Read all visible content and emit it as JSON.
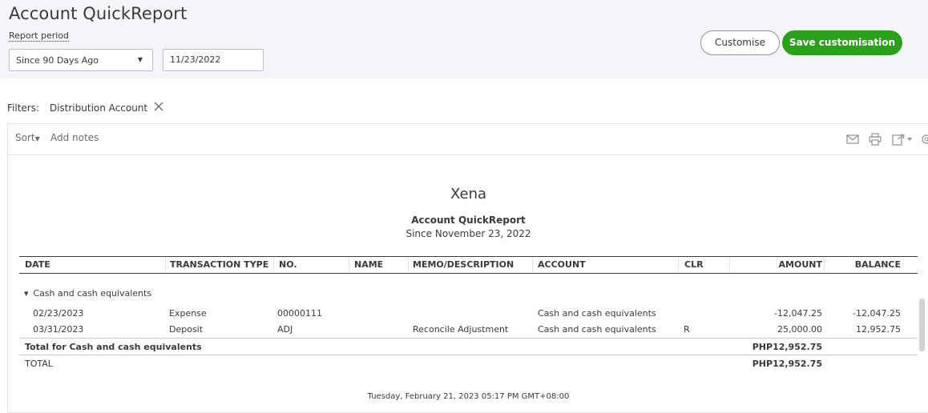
{
  "header": {
    "title": "Account QuickReport",
    "period_label": "Report period",
    "period_value": "Since 90 Days Ago",
    "date_value": "11/23/2022",
    "customise_label": "Customise",
    "save_label": "Save customisation"
  },
  "filters": {
    "label": "Filters:",
    "chip": "Distribution Account"
  },
  "toolbar": {
    "sort_label": "Sort",
    "add_notes_label": "Add notes",
    "icons": [
      "email-icon",
      "print-icon",
      "export-icon",
      "settings-icon"
    ]
  },
  "report": {
    "company": "Xena",
    "title": "Account QuickReport",
    "subtitle": "Since November 23, 2022",
    "columns": [
      "DATE",
      "TRANSACTION TYPE",
      "NO.",
      "NAME",
      "MEMO/DESCRIPTION",
      "ACCOUNT",
      "CLR",
      "AMOUNT",
      "BALANCE"
    ],
    "group_label": "Cash and cash equivalents",
    "rows": [
      {
        "date": "02/23/2023",
        "type": "Expense",
        "no": "00000111",
        "name": "",
        "memo": "",
        "account": "Cash and cash equivalents",
        "clr": "",
        "amount": "-12,047.25",
        "balance": "-12,047.25"
      },
      {
        "date": "03/31/2023",
        "type": "Deposit",
        "no": "ADJ",
        "name": "",
        "memo": "Reconcile Adjustment",
        "account": "Cash and cash equivalents",
        "clr": "R",
        "amount": "25,000.00",
        "balance": "12,952.75"
      }
    ],
    "group_total_label": "Total for Cash and cash equivalents",
    "group_total_amount": "PHP12,952.75",
    "total_label": "TOTAL",
    "total_amount": "PHP12,952.75",
    "timestamp": "Tuesday, February 21, 2023   05:17 PM GMT+08:00"
  },
  "colors": {
    "brand_green": "#2ca01c",
    "header_bg": "#f4f5f8"
  }
}
